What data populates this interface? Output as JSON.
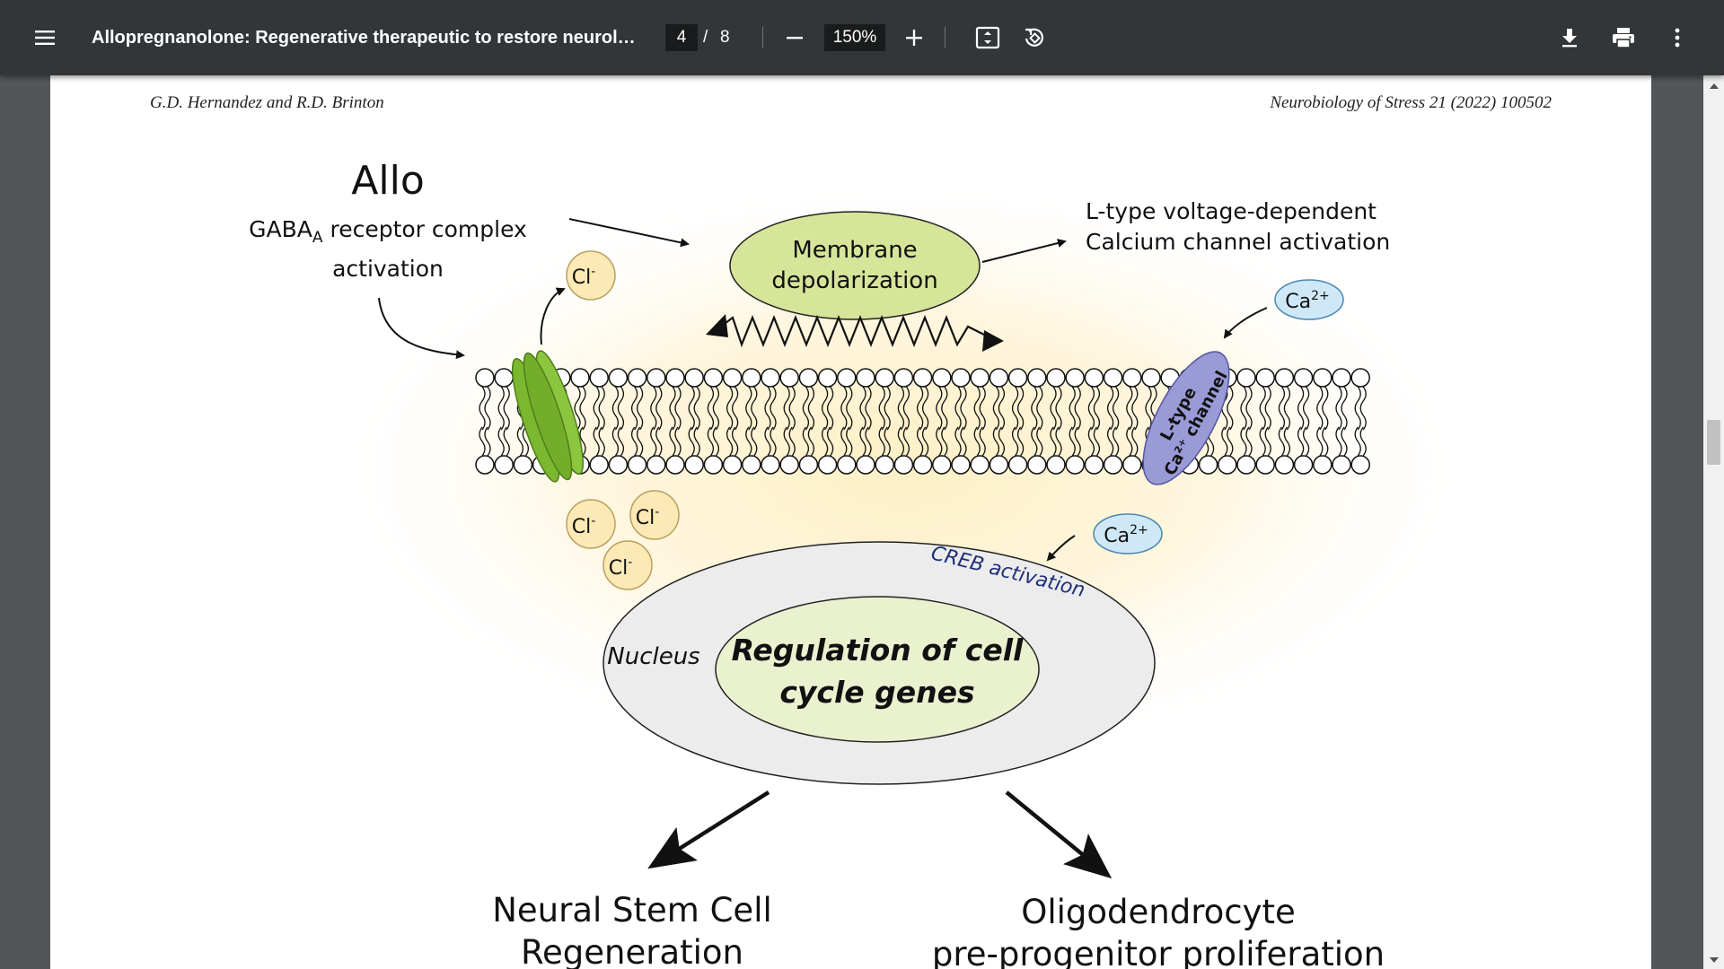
{
  "toolbar": {
    "title": "Allopregnanolone: Regenerative therapeutic to restore neurolog...",
    "current_page": "4",
    "page_separator": "/",
    "total_pages": "8",
    "zoom": "150%",
    "icons": {
      "menu": "menu-icon",
      "zoom_out": "minus-icon",
      "zoom_in": "plus-icon",
      "fit": "fit-to-page-icon",
      "rotate": "rotate-icon",
      "download": "download-icon",
      "print": "print-icon",
      "more": "more-vertical-icon"
    }
  },
  "page_header": {
    "authors": "G.D. Hernandez and R.D. Brinton",
    "journal": "Neurobiology of Stress 21 (2022) 100502"
  },
  "figure": {
    "allo": "Allo",
    "gaba_prefix": "GABA",
    "gaba_subscript": "A",
    "gaba_suffix": " receptor complex",
    "activation": "activation",
    "membrane_line1": "Membrane",
    "membrane_line2": "depolarization",
    "ltype_line1": "L-type voltage-dependent",
    "ltype_line2": "Calcium channel activation",
    "chloride": "Cl",
    "chloride_charge": "-",
    "calcium": "Ca",
    "calcium_charge": "2+",
    "channel_line1": "L-type",
    "channel_line2": "Ca²⁺ channel",
    "creb": "CREB activation",
    "nucleus": "Nucleus",
    "regulation_line1": "Regulation of cell",
    "regulation_line2": "cycle genes",
    "outcome_left_line1": "Neural Stem Cell",
    "outcome_left_line2": "Regeneration",
    "outcome_right_line1": "Oligodendrocyte",
    "outcome_right_line2": "pre-progenitor proliferation"
  },
  "colors": {
    "toolbar_bg": "#323639",
    "viewer_bg": "#525659",
    "membrane_green": "#d6e59a",
    "receptor_green": "#7cb82f",
    "channel_purple": "#9a9ad6",
    "chloride_fill": "#fde9b5",
    "calcium_fill": "#cfe8f7",
    "nucleus_fill": "#ececec",
    "regulation_fill": "#e9f1cf",
    "creb_text": "#1f2f7a"
  }
}
